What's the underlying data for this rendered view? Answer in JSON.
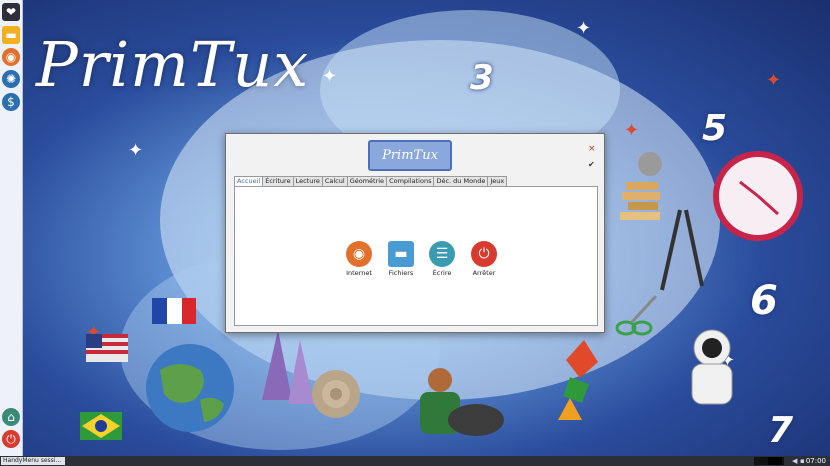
{
  "desktop": {
    "brand": "PrimTux",
    "numbers": [
      "3",
      "5",
      "6",
      "7"
    ]
  },
  "dock": {
    "items": [
      {
        "name": "menu",
        "icon": "heart-icon"
      },
      {
        "name": "files",
        "icon": "folder-icon"
      },
      {
        "name": "firefox",
        "icon": "globe-icon"
      },
      {
        "name": "handymenu",
        "icon": "leaf-icon"
      },
      {
        "name": "money",
        "icon": "dollar-icon"
      },
      {
        "name": "session",
        "icon": "session-icon"
      },
      {
        "name": "power",
        "icon": "power-icon"
      }
    ]
  },
  "window": {
    "banner": "PrimTux",
    "close_glyph": "×",
    "check_glyph": "✔",
    "tabs": [
      "Accueil",
      "Écriture",
      "Lecture",
      "Calcul",
      "Géométrie",
      "Compilations",
      "Déc. du Monde",
      "Jeux"
    ],
    "active_tab": "Accueil",
    "launchers": [
      {
        "label": "Internet",
        "icon": "firefox-icon",
        "color": "#e3702a"
      },
      {
        "label": "Fichiers",
        "icon": "folder-icon",
        "color": "#4a9ad4"
      },
      {
        "label": "Écrire",
        "icon": "document-icon",
        "color": "#3b9bb0"
      },
      {
        "label": "Arrêter",
        "icon": "power-icon",
        "color": "#d83a2e"
      }
    ]
  },
  "taskbar": {
    "task_label": "HandyMenu sessi...",
    "clock": "07:00"
  }
}
